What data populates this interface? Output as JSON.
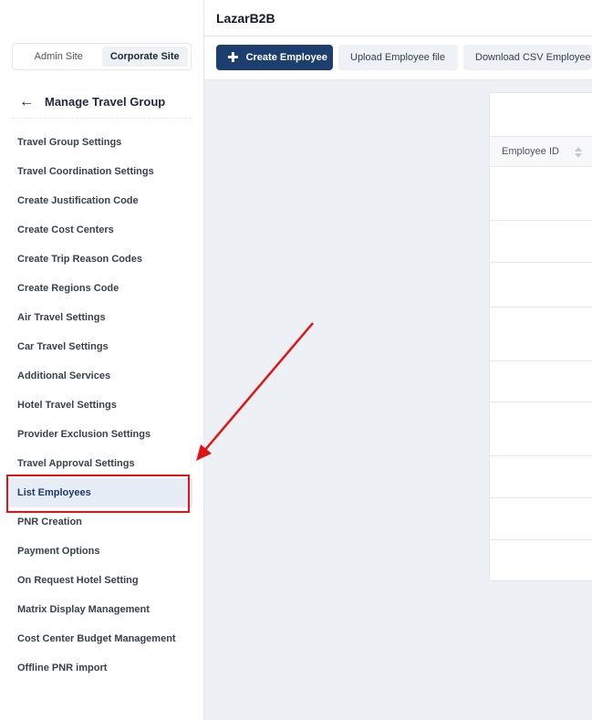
{
  "header": {
    "brand": "LazarB2B"
  },
  "site_switch": {
    "admin": "Admin Site",
    "corporate": "Corporate Site"
  },
  "sidebar": {
    "back_title": "Manage Travel Group",
    "items": [
      {
        "label": "Travel Group Settings"
      },
      {
        "label": "Travel Coordination Settings"
      },
      {
        "label": "Create Justification Code"
      },
      {
        "label": "Create Cost Centers"
      },
      {
        "label": "Create Trip Reason Codes"
      },
      {
        "label": "Create Regions Code"
      },
      {
        "label": "Air Travel Settings"
      },
      {
        "label": "Car Travel Settings"
      },
      {
        "label": "Additional Services"
      },
      {
        "label": "Hotel Travel Settings"
      },
      {
        "label": "Provider Exclusion Settings"
      },
      {
        "label": "Travel Approval Settings"
      },
      {
        "label": "List Employees",
        "active": true
      },
      {
        "label": "PNR Creation"
      },
      {
        "label": "Payment Options"
      },
      {
        "label": "On Request Hotel Setting"
      },
      {
        "label": "Matrix Display Management"
      },
      {
        "label": "Cost Center Budget Management"
      },
      {
        "label": "Offline PNR import"
      }
    ]
  },
  "toolbar": {
    "create": "Create Employee",
    "upload": "Upload Employee file",
    "download": "Download CSV Employee Da"
  },
  "table": {
    "columns": [
      "Employee ID"
    ]
  },
  "colors": {
    "primary": "#1d3f70",
    "annotation": "#e01414",
    "active_bg": "#e6edf6"
  }
}
